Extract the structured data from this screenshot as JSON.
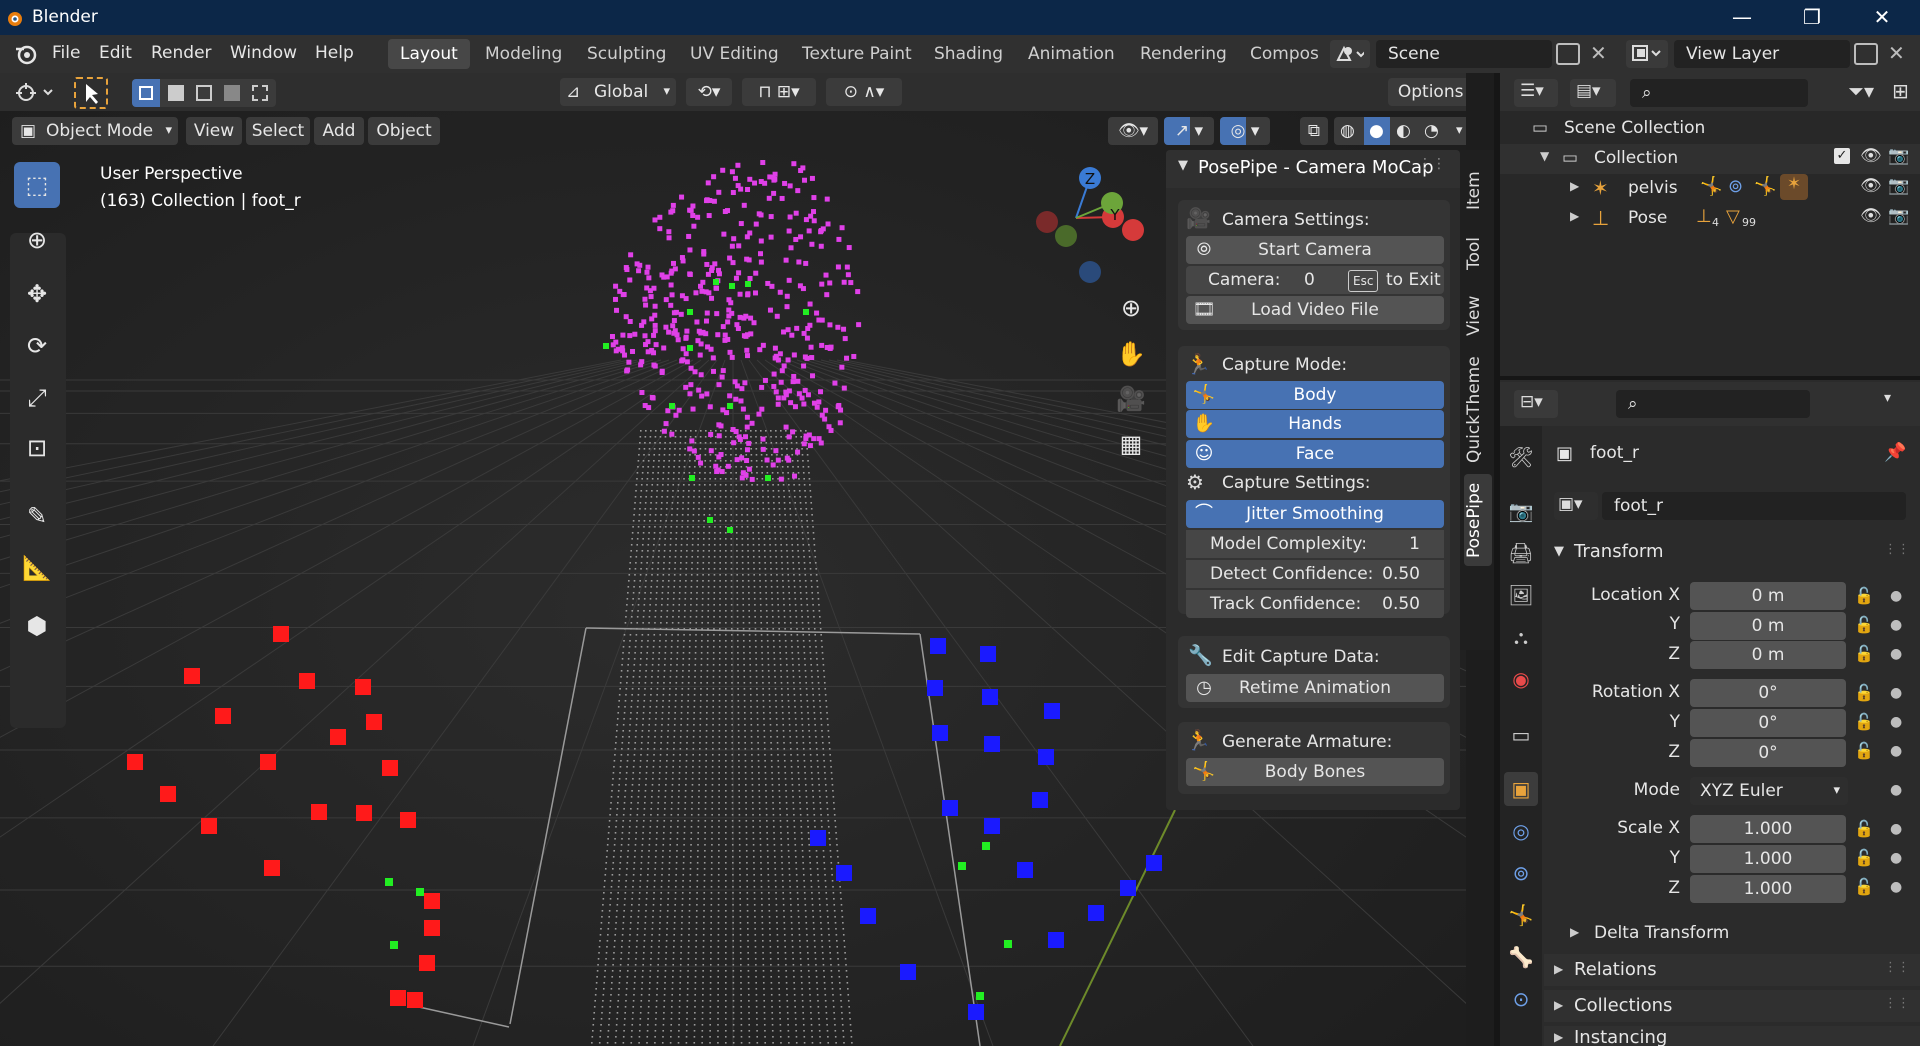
{
  "app": {
    "title": "Blender"
  },
  "window_controls": {
    "minimize": "—",
    "maximize": "❐",
    "close": "✕"
  },
  "menu": {
    "items": [
      "File",
      "Edit",
      "Render",
      "Window",
      "Help"
    ]
  },
  "workspaces": [
    "Layout",
    "Modeling",
    "Sculpting",
    "UV Editing",
    "Texture Paint",
    "Shading",
    "Animation",
    "Rendering",
    "Compos"
  ],
  "scene": {
    "name": "Scene",
    "view_layer": "View Layer"
  },
  "viewport_header": {
    "transform_orientation": "Global",
    "options_label": "Options",
    "mode": "Object Mode",
    "menus": [
      "View",
      "Select",
      "Add",
      "Object"
    ]
  },
  "viewport": {
    "overlay_line1": "User Perspective",
    "overlay_line2": "(163) Collection | foot_r",
    "gizmo": {
      "z": "Z",
      "y": "Y",
      "x": "X"
    }
  },
  "side_tabs": [
    "Item",
    "Tool",
    "View",
    "QuickTheme",
    "PosePipe"
  ],
  "posepipe": {
    "title": "PosePipe - Camera MoCap",
    "camera_settings_label": "Camera Settings:",
    "start_camera": "Start Camera",
    "camera_label": "Camera:",
    "camera_value": "0",
    "esc_key": "Esc",
    "to_exit": "to Exit",
    "load_video": "Load Video File",
    "capture_mode_label": "Capture Mode:",
    "mode_body": "Body",
    "mode_hands": "Hands",
    "mode_face": "Face",
    "capture_settings_label": "Capture Settings:",
    "jitter_smoothing": "Jitter Smoothing",
    "model_complexity_label": "Model Complexity:",
    "model_complexity_value": "1",
    "detect_conf_label": "Detect Confidence:",
    "detect_conf_value": "0.50",
    "track_conf_label": "Track Confidence:",
    "track_conf_value": "0.50",
    "edit_capture_label": "Edit Capture Data:",
    "retime_animation": "Retime Animation",
    "generate_armature_label": "Generate Armature:",
    "body_bones": "Body Bones"
  },
  "outliner": {
    "scene_collection": "Scene Collection",
    "collection": "Collection",
    "items": [
      {
        "name": "pelvis",
        "badge": ""
      },
      {
        "name": "Pose",
        "badge1": "4",
        "badge2": "99"
      }
    ]
  },
  "properties": {
    "object_name": "foot_r",
    "datablock_name": "foot_r",
    "transform_label": "Transform",
    "location": {
      "label_x": "Location X",
      "label_y": "Y",
      "label_z": "Z",
      "x": "0 m",
      "y": "0 m",
      "z": "0 m"
    },
    "rotation": {
      "label_x": "Rotation X",
      "label_y": "Y",
      "label_z": "Z",
      "x": "0°",
      "y": "0°",
      "z": "0°"
    },
    "mode_label": "Mode",
    "mode_value": "XYZ Euler",
    "scale": {
      "label_x": "Scale X",
      "label_y": "Y",
      "label_z": "Z",
      "x": "1.000",
      "y": "1.000",
      "z": "1.000"
    },
    "subsections": [
      "Delta Transform",
      "Relations",
      "Collections",
      "Instancing"
    ]
  },
  "colors": {
    "accent": "#4772b3",
    "face_points": "#e040e8",
    "left_hand": "#ff1a1a",
    "right_hand": "#1a1aff",
    "tracker": "#22ee22"
  }
}
